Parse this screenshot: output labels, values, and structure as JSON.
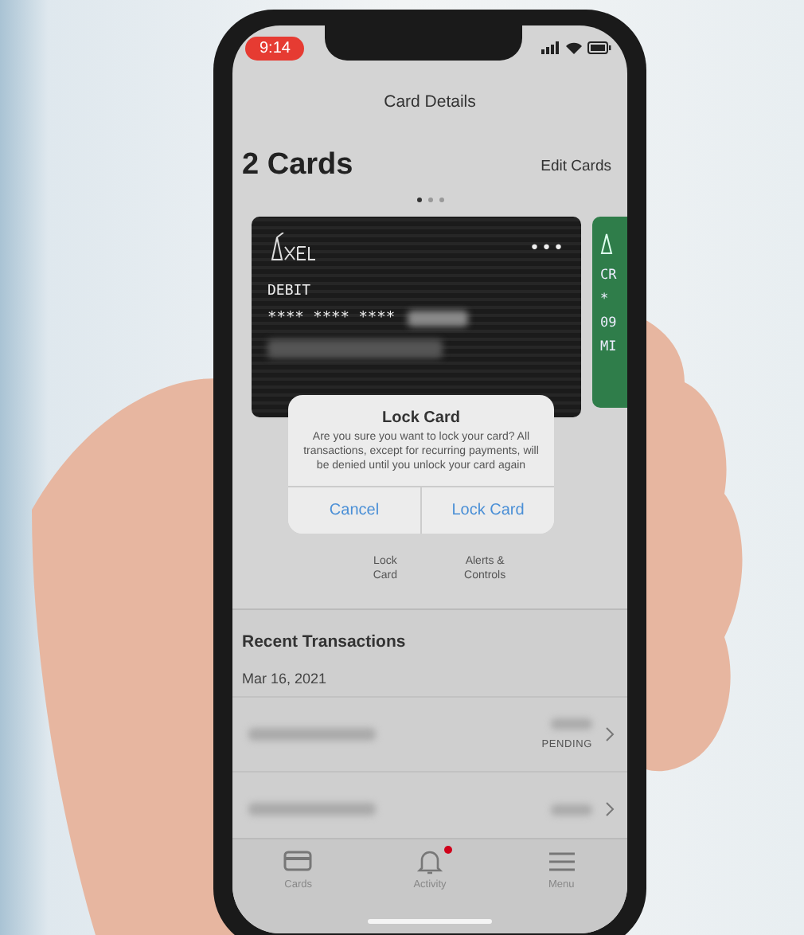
{
  "status_bar": {
    "time": "9:14"
  },
  "header": {
    "title": "Card Details"
  },
  "cards_header": {
    "heading": "2 Cards",
    "edit_link": "Edit Cards"
  },
  "page_dots": [
    {
      "selected": true
    },
    {
      "selected": false
    },
    {
      "selected": false
    }
  ],
  "cards": [
    {
      "kind": "debit",
      "type_label": "DEBIT",
      "number": "**** **** ****",
      "more": "•••"
    },
    {
      "kind": "credit",
      "lines": [
        "CR",
        "*",
        "09",
        "MI"
      ]
    }
  ],
  "card_actions": [
    {
      "label": "Lock\nCard"
    },
    {
      "label": "Alerts &\nControls"
    }
  ],
  "dialog": {
    "title": "Lock Card",
    "message": "Are you sure you want to lock your card? All transactions, except for recurring payments, will be denied until you unlock your card again",
    "buttons": [
      "Cancel",
      "Lock Card"
    ]
  },
  "transactions": {
    "title": "Recent Transactions",
    "date": "Mar 16, 2021",
    "rows": [
      {
        "pending": true,
        "status": "PENDING"
      },
      {
        "pending": false
      }
    ]
  },
  "tab_bar": [
    {
      "label": "Cards",
      "kind": "card",
      "selected": false,
      "badge": false
    },
    {
      "label": "Activity",
      "kind": "bell",
      "selected": false,
      "badge": true
    },
    {
      "label": "Menu",
      "kind": "menu",
      "selected": false,
      "badge": false
    }
  ]
}
